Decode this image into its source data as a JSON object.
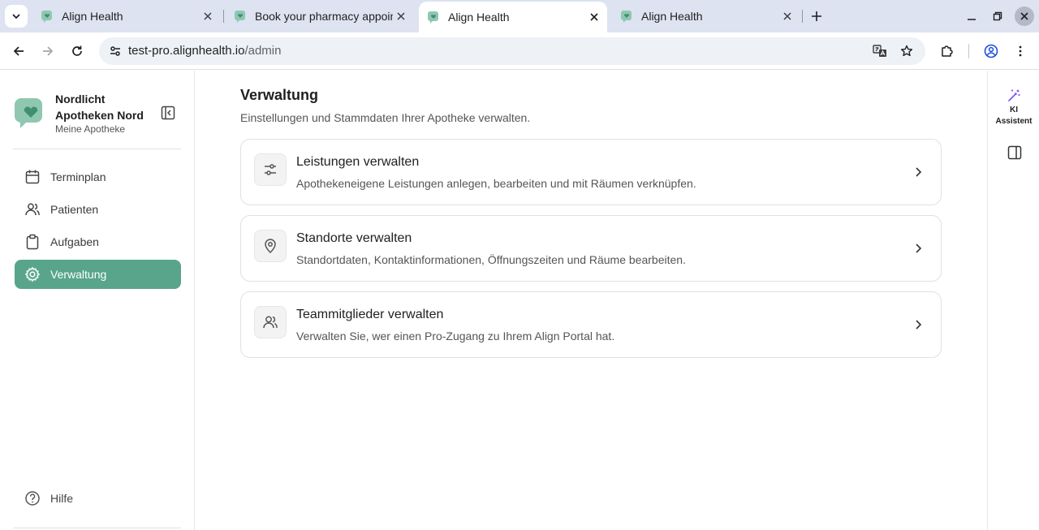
{
  "browser": {
    "tabs": [
      {
        "title": "Align Health",
        "active": false
      },
      {
        "title": "Book your pharmacy appointment",
        "active": false
      },
      {
        "title": "Align Health",
        "active": true
      },
      {
        "title": "Align Health",
        "active": false
      }
    ],
    "url_host": "test-pro.alignhealth.io",
    "url_path": "/admin"
  },
  "sidebar": {
    "org_name": "Nordlicht Apotheken Nord",
    "org_subtitle": "Meine Apotheke",
    "items": [
      {
        "label": "Terminplan",
        "icon": "calendar-icon"
      },
      {
        "label": "Patienten",
        "icon": "users-icon"
      },
      {
        "label": "Aufgaben",
        "icon": "clipboard-icon"
      },
      {
        "label": "Verwaltung",
        "icon": "gear-icon",
        "active": true
      }
    ],
    "help_label": "Hilfe"
  },
  "main": {
    "title": "Verwaltung",
    "subtitle": "Einstellungen und Stammdaten Ihrer Apotheke verwalten.",
    "cards": [
      {
        "title": "Leistungen verwalten",
        "description": "Apothekeneigene Leistungen anlegen, bearbeiten und mit Räumen verknüpfen.",
        "icon": "sliders-icon"
      },
      {
        "title": "Standorte verwalten",
        "description": "Standortdaten, Kontaktinformationen, Öffnungszeiten und Räume bearbeiten.",
        "icon": "map-pin-icon"
      },
      {
        "title": "Teammitglieder verwalten",
        "description": "Verwalten Sie, wer einen Pro-Zugang zu Ihrem Align Portal hat.",
        "icon": "team-icon"
      }
    ]
  },
  "rightbar": {
    "ai_label_line1": "KI",
    "ai_label_line2": "Assistent"
  },
  "colors": {
    "accent": "#58a58c",
    "tabbar": "#dde3f0",
    "ai_icon": "#7c4dff"
  }
}
